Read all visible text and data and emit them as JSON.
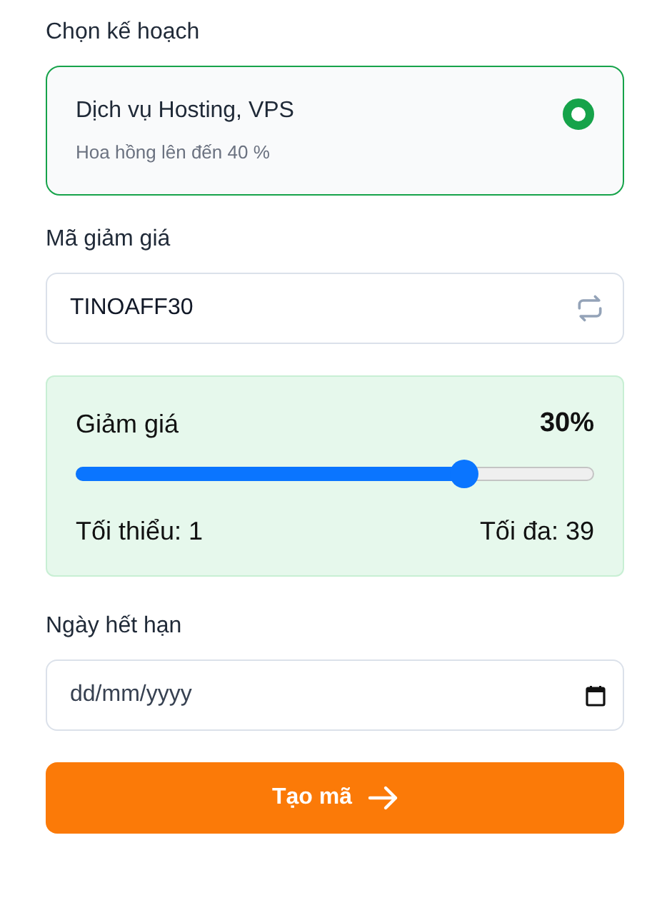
{
  "plan_section": {
    "label": "Chọn kế hoạch",
    "plans": [
      {
        "name": "Dịch vụ Hosting, VPS",
        "note": "Hoa hồng lên đến 40 %",
        "selected": true
      }
    ]
  },
  "coupon": {
    "label": "Mã giảm giá",
    "value": "TINOAFF30"
  },
  "discount": {
    "label": "Giảm giá",
    "reading": "30%",
    "level": 0.75,
    "min_label": "Tối thiểu: 1",
    "max_label": "Tối đa: 39"
  },
  "expiry": {
    "label": "Ngày hết hạn",
    "placeholder": "dd/mm/yyyy"
  },
  "submit": {
    "label": "Tạo mã"
  }
}
